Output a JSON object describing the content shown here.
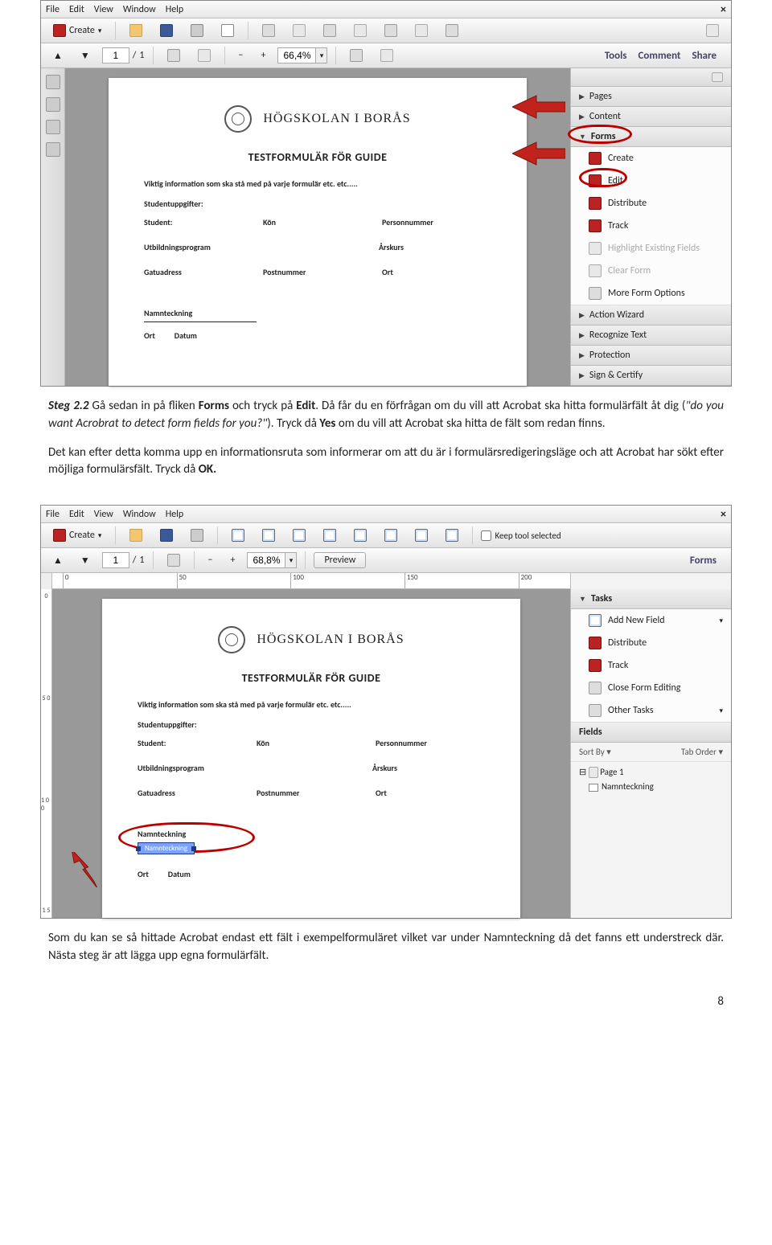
{
  "menubar": [
    "File",
    "Edit",
    "View",
    "Window",
    "Help"
  ],
  "s1": {
    "createLabel": "Create",
    "page_current": "1",
    "page_total": "1",
    "zoom": "66,4%",
    "rightlinks": [
      "Tools",
      "Comment",
      "Share"
    ],
    "rpanel": {
      "pages": "Pages",
      "content": "Content",
      "forms": "Forms",
      "actions": [
        "Create",
        "Edit",
        "Distribute",
        "Track",
        "Highlight Existing Fields",
        "Clear Form",
        "More Form Options"
      ],
      "action_wizard": "Action Wizard",
      "recognize": "Recognize Text",
      "protection": "Protection",
      "sign": "Sign & Certify"
    }
  },
  "doc": {
    "org": "HÖGSKOLAN I BORÅS",
    "title": "TESTFORMULÄR FÖR GUIDE",
    "info": "Viktig information som ska stå med på varje formulär etc. etc.....",
    "studentHdr": "Studentuppgifter:",
    "fields": {
      "student": "Student:",
      "kon": "Kön",
      "pnr": "Personnummer",
      "prog": "Utbildningsprogram",
      "arsk": "Årskurs",
      "gata": "Gatuadress",
      "postnr": "Postnummer",
      "ort": "Ort",
      "namnt": "Namnteckning",
      "datum": "Datum"
    }
  },
  "text": {
    "p1a": "Steg 2.2",
    "p1b": " Gå sedan in på fliken ",
    "p1c": "Forms",
    "p1d": " och tryck på ",
    "p1e": "Edit",
    "p1f": ". Då får du en förfrågan om du vill att Acrobat ska hitta formulärfält åt dig (",
    "p1g": "\"do you want Acrobrat to detect form fields for you?\"",
    "p1h": "). Tryck då ",
    "p1i": "Yes",
    "p1j": " om du vill att Acrobat ska hitta de fält som redan finns.",
    "p2a": "Det kan efter detta komma upp en informationsruta som informerar om att du är i formulärsredigeringsläge och att Acrobat har sökt efter möjliga formulärsfält. Tryck då ",
    "p2b": "OK.",
    "p3": "Som du kan se så hittade Acrobat endast ett fält i exempelformuläret vilket var under Namnteckning då det fanns ett understreck där. Nästa steg är att lägga upp egna formulärfält."
  },
  "s2": {
    "zoom": "68,8%",
    "keep": "Keep tool selected",
    "preview": "Preview",
    "forms": "Forms",
    "tasks": "Tasks",
    "taskitems": [
      "Add New Field",
      "Distribute",
      "Track",
      "Close Form Editing",
      "Other Tasks"
    ],
    "fields": "Fields",
    "sortby": "Sort By",
    "taborder": "Tab Order",
    "pg1": "Page 1",
    "fieldname": "Namnteckning",
    "ruler": [
      "0",
      "50",
      "100",
      "150",
      "200"
    ],
    "vruler": [
      "0",
      "5 0",
      "1 0 0",
      "1 5"
    ]
  },
  "pageno": "8"
}
